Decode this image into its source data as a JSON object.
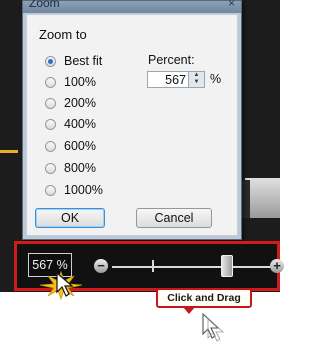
{
  "dialog": {
    "title": "Zoom",
    "close_glyph": "×",
    "group_label": "Zoom to",
    "options": [
      {
        "label": "Best fit",
        "checked": true
      },
      {
        "label": "100%",
        "checked": false
      },
      {
        "label": "200%",
        "checked": false
      },
      {
        "label": "400%",
        "checked": false
      },
      {
        "label": "600%",
        "checked": false
      },
      {
        "label": "800%",
        "checked": false
      },
      {
        "label": "1000%",
        "checked": false
      }
    ],
    "percent_label": "Percent:",
    "percent_value": "567",
    "percent_sign": "%",
    "ok_label": "OK",
    "cancel_label": "Cancel"
  },
  "zoombar": {
    "value_display": "567 %",
    "minus_glyph": "−",
    "plus_glyph": "+",
    "slider_level_fraction": 0.72
  },
  "annotation": {
    "callout_text": "Click and Drag"
  },
  "colors": {
    "highlight_border": "#d21c1c",
    "click_burst": "#f4c21a",
    "dialog_frame": "#bdc9d6",
    "dialog_body": "#f2f2f2",
    "app_background": "#1c1c1c"
  },
  "icons": [
    "close-icon",
    "radio-icon",
    "spin-up-icon",
    "spin-down-icon",
    "zoom-out-icon",
    "zoom-in-icon",
    "mouse-cursor-icon",
    "click-burst-icon"
  ]
}
